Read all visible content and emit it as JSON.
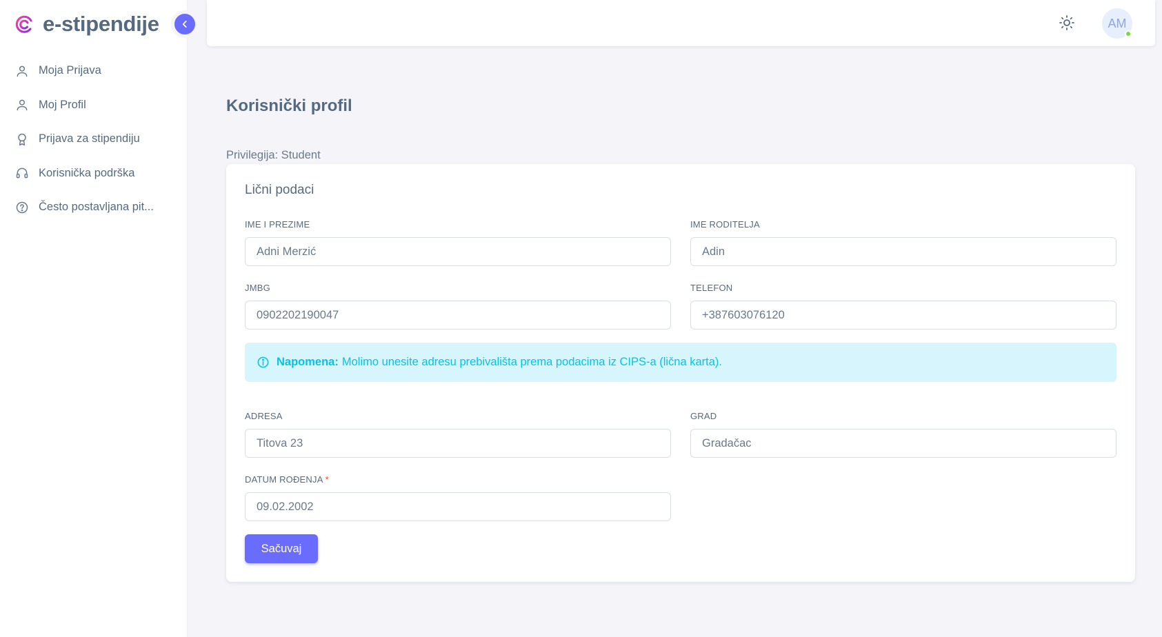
{
  "brand": {
    "name": "e-stipendije"
  },
  "colors": {
    "primary": "#696cff",
    "info": "#03c3ec",
    "text": "#566a7f",
    "online": "#71dd37"
  },
  "sidebar": {
    "items": [
      {
        "label": "Moja Prijava",
        "icon": "user-icon"
      },
      {
        "label": "Moj Profil",
        "icon": "user-icon"
      },
      {
        "label": "Prijava za stipendiju",
        "icon": "award-icon"
      },
      {
        "label": "Korisnička podrška",
        "icon": "headset-icon"
      },
      {
        "label": "Često postavljana pit...",
        "icon": "help-circle-icon"
      }
    ]
  },
  "topbar": {
    "avatar_initials": "AM"
  },
  "page": {
    "title": "Korisnički profil",
    "privilege": "Privilegija: Student"
  },
  "card": {
    "title": "Lični podaci",
    "fields": {
      "full_name": {
        "label": "IME I PREZIME",
        "value": "Adni Merzić"
      },
      "parent_name": {
        "label": "IME RODITELJA",
        "value": "Adin"
      },
      "jmbg": {
        "label": "JMBG",
        "value": "0902202190047"
      },
      "phone": {
        "label": "TELEFON",
        "value": "+387603076120"
      },
      "address": {
        "label": "ADRESA",
        "value": "Titova 23"
      },
      "city": {
        "label": "GRAD",
        "value": "Gradačac"
      },
      "birth_date": {
        "label": "DATUM ROĐENJA",
        "required_mark": "*",
        "value": "09.02.2002"
      }
    },
    "alert": {
      "strong": "Napomena:",
      "text": "Molimo unesite adresu prebivališta prema podacima iz CIPS-a (lična karta)."
    },
    "save_label": "Sačuvaj"
  }
}
